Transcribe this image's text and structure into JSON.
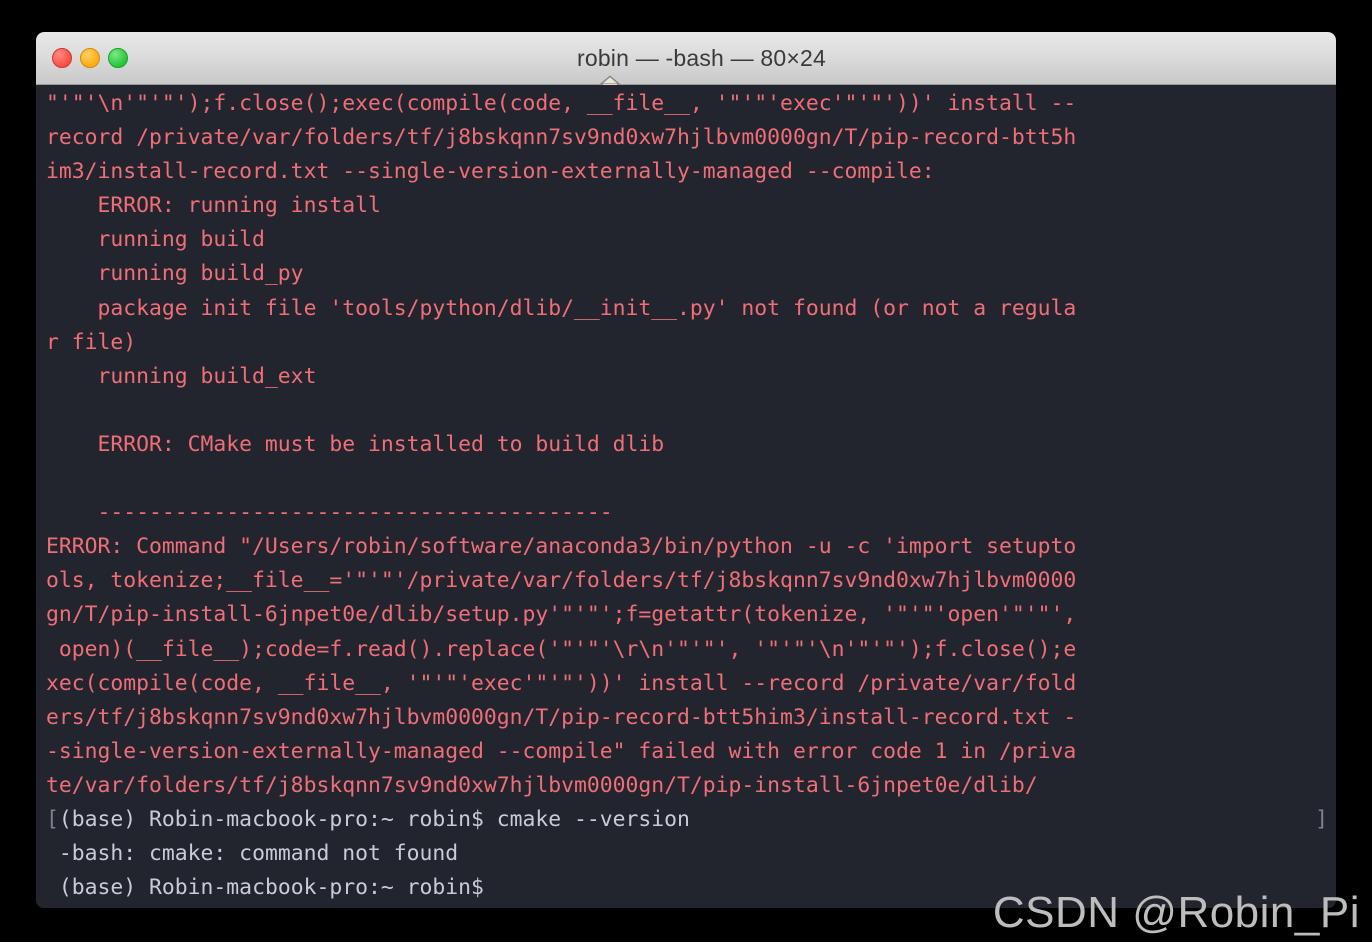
{
  "window": {
    "title": "robin — -bash — 80×24",
    "icon": "home-icon",
    "buttons": {
      "close": "close-button",
      "minimize": "minimize-button",
      "maximize": "maximize-button"
    }
  },
  "colors": {
    "background": "#22252e",
    "error_text": "#ef6e77",
    "prompt_text": "#c7ccd8",
    "wrap_marker": "#7b8494",
    "desktop": "#000000",
    "titlebar_top": "#e8e8e8",
    "titlebar_bottom": "#c9c9c9"
  },
  "terminal": {
    "cols": 80,
    "rows": 24,
    "lines": [
      {
        "text": "\"'\"'\\n'\"'\"');f.close();exec(compile(code, __file__, '\"'\"'exec'\"'\"'))' install --",
        "color": "red"
      },
      {
        "text": "record /private/var/folders/tf/j8bskqnn7sv9nd0xw7hjlbvm0000gn/T/pip-record-btt5h",
        "color": "red"
      },
      {
        "text": "im3/install-record.txt --single-version-externally-managed --compile:",
        "color": "red"
      },
      {
        "text": "    ERROR: running install",
        "color": "red"
      },
      {
        "text": "    running build",
        "color": "red"
      },
      {
        "text": "    running build_py",
        "color": "red"
      },
      {
        "text": "    package init file 'tools/python/dlib/__init__.py' not found (or not a regula",
        "color": "red"
      },
      {
        "text": "r file)",
        "color": "red"
      },
      {
        "text": "    running build_ext",
        "color": "red"
      },
      {
        "text": "",
        "color": "red"
      },
      {
        "text": "    ERROR: CMake must be installed to build dlib",
        "color": "red"
      },
      {
        "text": "",
        "color": "red"
      },
      {
        "text": "    ----------------------------------------",
        "color": "red"
      },
      {
        "text": "ERROR: Command \"/Users/robin/software/anaconda3/bin/python -u -c 'import setupto",
        "color": "red"
      },
      {
        "text": "ols, tokenize;__file__='\"'\"'/private/var/folders/tf/j8bskqnn7sv9nd0xw7hjlbvm0000",
        "color": "red"
      },
      {
        "text": "gn/T/pip-install-6jnpet0e/dlib/setup.py'\"'\"';f=getattr(tokenize, '\"'\"'open'\"'\"',",
        "color": "red"
      },
      {
        "text": " open)(__file__);code=f.read().replace('\"'\"'\\r\\n'\"'\"', '\"'\"'\\n'\"'\"');f.close();e",
        "color": "red"
      },
      {
        "text": "xec(compile(code, __file__, '\"'\"'exec'\"'\"'))' install --record /private/var/fold",
        "color": "red"
      },
      {
        "text": "ers/tf/j8bskqnn7sv9nd0xw7hjlbvm0000gn/T/pip-record-btt5him3/install-record.txt -",
        "color": "red"
      },
      {
        "text": "-single-version-externally-managed --compile\" failed with error code 1 in /priva",
        "color": "red"
      },
      {
        "text": "te/var/folders/tf/j8bskqnn7sv9nd0xw7hjlbvm0000gn/T/pip-install-6jnpet0e/dlib/",
        "color": "red"
      },
      {
        "text": "(base) Robin-macbook-pro:~ robin$ cmake --version",
        "color": "white",
        "wrap_open": "[",
        "wrap_close": "]"
      },
      {
        "text": "-bash: cmake: command not found",
        "color": "white"
      },
      {
        "text": "(base) Robin-macbook-pro:~ robin$",
        "color": "white"
      }
    ]
  },
  "watermark": {
    "text": "CSDN @Robin_Pi"
  }
}
